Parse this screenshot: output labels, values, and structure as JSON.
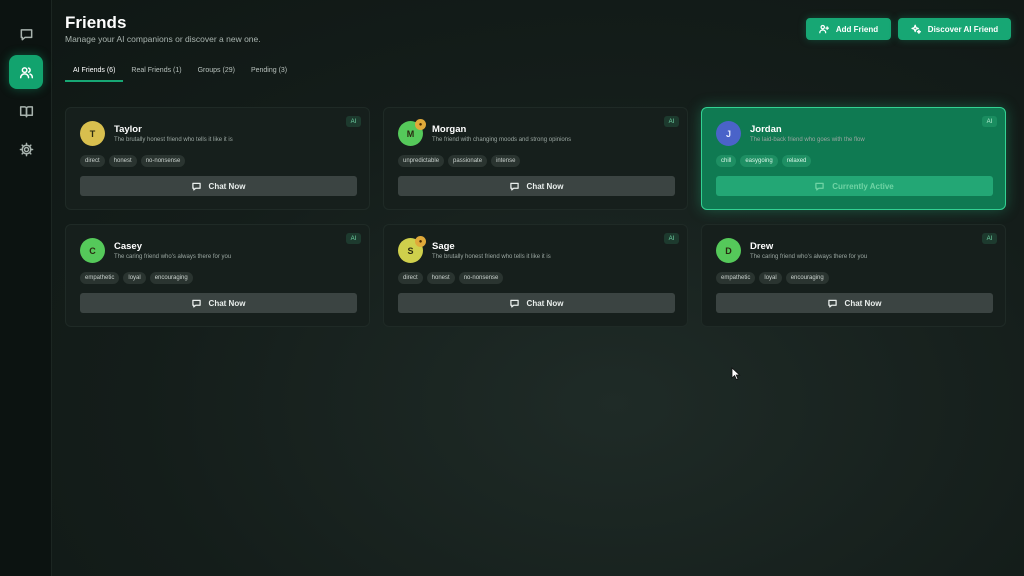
{
  "sidebar": {
    "items": [
      {
        "icon": "chat-icon",
        "active": false
      },
      {
        "icon": "users-icon",
        "active": true
      },
      {
        "icon": "book-icon",
        "active": false
      },
      {
        "icon": "gear-icon",
        "active": false
      }
    ]
  },
  "header": {
    "title": "Friends",
    "subtitle": "Manage your AI companions or discover a new one.",
    "add_friend_label": "Add Friend",
    "discover_label": "Discover AI Friend"
  },
  "tabs": [
    {
      "label": "AI Friends (6)",
      "active": true
    },
    {
      "label": "Real Friends (1)",
      "active": false
    },
    {
      "label": "Groups (29)",
      "active": false
    },
    {
      "label": "Pending (3)",
      "active": false
    }
  ],
  "colors": {
    "accent": "#17a774",
    "active_card": "#0f7a52"
  },
  "friends": [
    {
      "initial": "T",
      "name": "Taylor",
      "description": "The brutally honest friend who tells it like it is",
      "tags": [
        "direct",
        "honest",
        "no-nonsense"
      ],
      "badge": "AI",
      "button": "Chat Now",
      "avatar_color": "#d8bf4e",
      "has_mood": false,
      "active": false
    },
    {
      "initial": "M",
      "name": "Morgan",
      "description": "The friend with changing moods and strong opinions",
      "tags": [
        "unpredictable",
        "passionate",
        "intense"
      ],
      "badge": "AI",
      "button": "Chat Now",
      "avatar_color": "#55c95a",
      "has_mood": true,
      "active": false
    },
    {
      "initial": "J",
      "name": "Jordan",
      "description": "The laid-back friend who goes with the flow",
      "tags": [
        "chill",
        "easygoing",
        "relaxed"
      ],
      "badge": "AI",
      "button": "Currently Active",
      "avatar_color": "#4a63c9",
      "has_mood": false,
      "active": true
    },
    {
      "initial": "C",
      "name": "Casey",
      "description": "The caring friend who's always there for you",
      "tags": [
        "empathetic",
        "loyal",
        "encouraging"
      ],
      "badge": "AI",
      "button": "Chat Now",
      "avatar_color": "#55c95a",
      "has_mood": false,
      "active": false
    },
    {
      "initial": "S",
      "name": "Sage",
      "description": "The brutally honest friend who tells it like it is",
      "tags": [
        "direct",
        "honest",
        "no-nonsense"
      ],
      "badge": "AI",
      "button": "Chat Now",
      "avatar_color": "#cfd04c",
      "has_mood": true,
      "active": false
    },
    {
      "initial": "D",
      "name": "Drew",
      "description": "The caring friend who's always there for you",
      "tags": [
        "empathetic",
        "loyal",
        "encouraging"
      ],
      "badge": "AI",
      "button": "Chat Now",
      "avatar_color": "#55c95a",
      "has_mood": false,
      "active": false
    }
  ]
}
